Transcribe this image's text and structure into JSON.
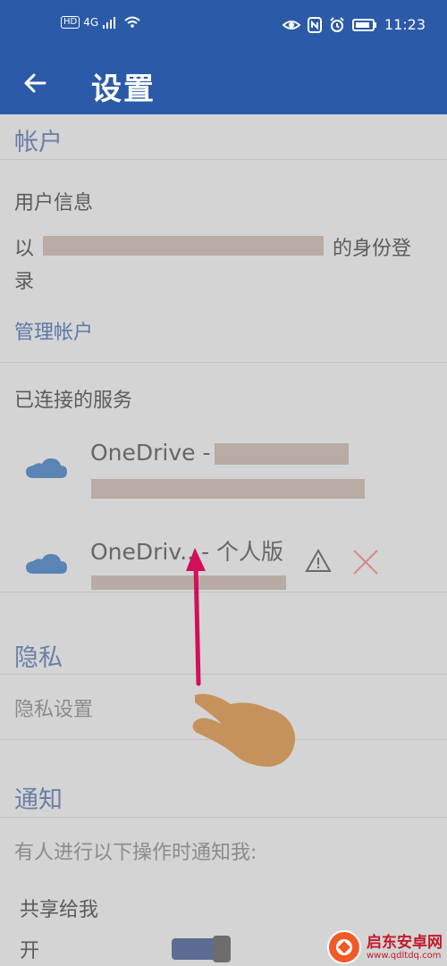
{
  "status_bar": {
    "left_items": [
      "HD",
      "4G"
    ],
    "time": "11:23"
  },
  "app_bar": {
    "title": "设置"
  },
  "sections": {
    "account": {
      "header": "帐户",
      "user_info_label": "用户信息",
      "signin_prefix": "以",
      "signin_suffix": "的身份登",
      "signin_wrap": "录",
      "manage_account": "管理帐户",
      "connected_services_label": "已连接的服务",
      "services": [
        {
          "name": "OneDrive -"
        },
        {
          "name": "OneDriv...- 个人版"
        }
      ]
    },
    "privacy": {
      "header": "隐私",
      "settings": "隐私设置"
    },
    "notifications": {
      "header": "通知",
      "notify_me": "有人进行以下操作时通知我:",
      "shared_with_me": "共享给我",
      "toggle_label": "开"
    }
  },
  "watermark": {
    "title": "启东安卓网",
    "url": "www.qdltdq.com"
  },
  "colors": {
    "primary": "#2b5aa8",
    "overlay": "#d4d4d4",
    "header_text": "#6c7fa6",
    "link_text": "#5d79a8",
    "gesture_arrow": "#d10f5b",
    "gesture_hand": "#c6925b"
  }
}
